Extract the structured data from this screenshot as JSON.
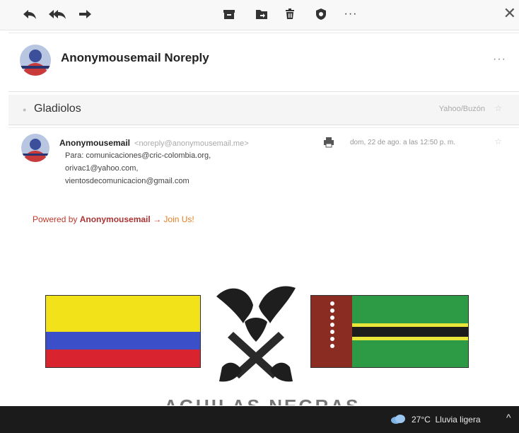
{
  "toolbar": {
    "reply_icon": "reply-icon",
    "reply_all_icon": "reply-all-icon",
    "forward_icon": "forward-icon",
    "archive_icon": "archive-icon",
    "move_icon": "move-icon",
    "delete_icon": "delete-icon",
    "spam_icon": "spam-shield-icon",
    "more_label": "···",
    "close_label": "✕"
  },
  "header": {
    "sender_name": "Anonymousemail Noreply",
    "more_label": "···"
  },
  "subject": {
    "text": "Gladiolos",
    "folder": "Yahoo/Buzón",
    "star": "☆"
  },
  "message": {
    "from_name": "Anonymousemail",
    "from_address": "<noreply@anonymousemail.me>",
    "to_line": "Para: comunicaciones@cric-colombia.org,",
    "to_2": "orivac1@yahoo.com,",
    "to_3": "vientosdecomunicacion@gmail.com",
    "date": "dom, 22 de ago. a las 12:50 p. m.",
    "star": "☆",
    "powered_prefix": "Powered by ",
    "powered_brand": "Anonymousemail",
    "powered_arrow": " → ",
    "powered_join": "Join Us!",
    "partial_heading": "AGUILAS NEGRAS"
  },
  "taskbar": {
    "temperature": "27°C",
    "condition": "Lluvia ligera",
    "caret": "^"
  },
  "colors": {
    "accent_red": "#c0392b",
    "join_orange": "#e67e22"
  }
}
